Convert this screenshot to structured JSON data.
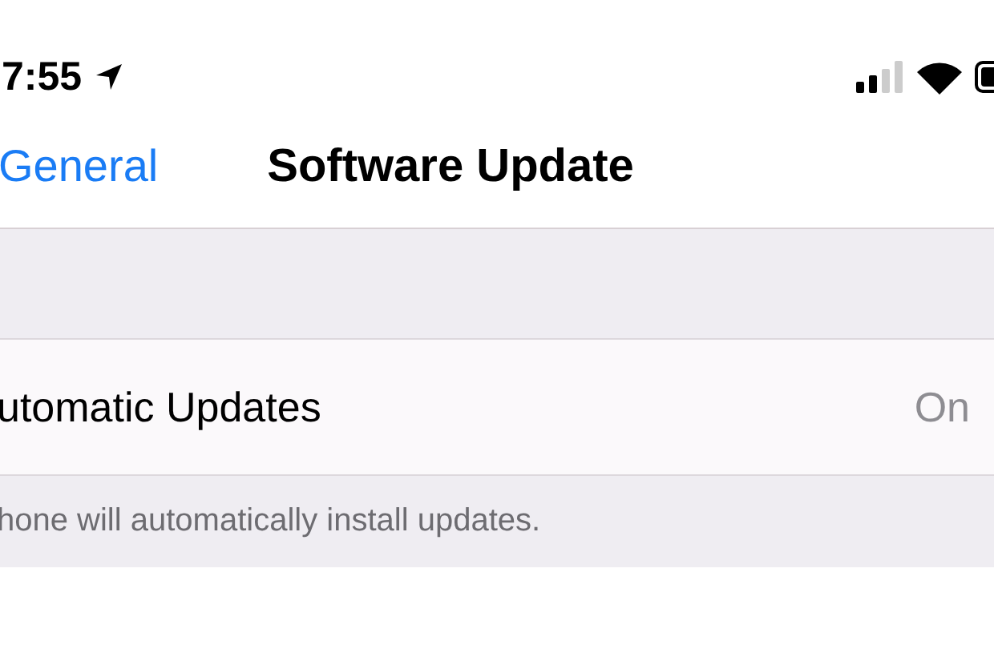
{
  "status_bar": {
    "time": "7:55"
  },
  "nav": {
    "back": "General",
    "title": "Software Update"
  },
  "rows": [
    {
      "label": "utomatic Updates",
      "value": "On"
    }
  ],
  "footer": "hone will automatically install updates."
}
